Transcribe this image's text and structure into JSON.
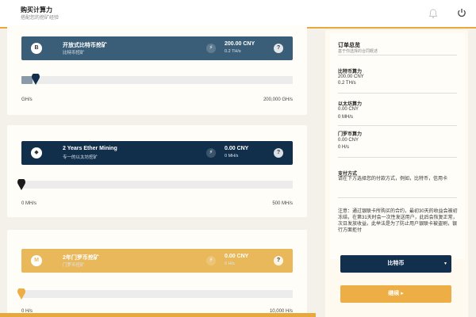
{
  "header": {
    "title": "购买计算力",
    "subtitle": "搭配您的挖矿经验"
  },
  "plans": [
    {
      "coin_icon": "B",
      "name": "开放式比特币挖矿",
      "desc": "比特币挖矿",
      "price": "200.00 CNY",
      "rate": "0.2 TH/s",
      "help": "?",
      "bolt": "⚡",
      "range_min": "GH/s",
      "range_max": "200,000 GH/s",
      "level": 0.03
    },
    {
      "coin_icon": "◆",
      "name": "2 Years Ether Mining",
      "desc": "专一的以太坊挖矿",
      "price": "0.00 CNY",
      "rate": "0 MH/s",
      "help": "?",
      "bolt": "⚡",
      "range_min": "0 MH/s",
      "range_max": "500 MH/s",
      "level": 0
    },
    {
      "coin_icon": "M",
      "name": "2年门罗币挖矿",
      "desc": "门罗币挖矿",
      "price": "0.00 CNY",
      "rate": "0 H/s",
      "help": "?",
      "bolt": "⚡",
      "range_min": "0 H/s",
      "range_max": "10,000 H/s",
      "level": 0
    }
  ],
  "summary": {
    "title": "订单总览",
    "subtitle": "基于你选择的合同概述",
    "btc_label": "比特币算力",
    "btc_price": "200.00 CNY",
    "btc_rate": "0.2 TH/s",
    "eth_label": "以太坊算力",
    "eth_price": "0.00 CNY",
    "eth_rate": "0 MH/s",
    "xmr_label": "门罗币算力",
    "xmr_price": "0.00 CNY",
    "xmr_rate": "0 H/s",
    "payment_title": "支付方式",
    "payment_text": "请在下方选择您的付款方式，例如，比特币，信用卡",
    "note": "注意：通过银联卡所购买的合约，最初30天的收益会被初冻结，在第31天时会一次性发送用户，此后会恢复正常，次日发放收益。此举法是为了防止用户银联卡被盗刷，银行方面拒付"
  },
  "buttons": {
    "method": "比特币",
    "method_caret": "▾",
    "continue": "继续 ▸"
  },
  "colors": {
    "accent": "#e9a93a",
    "navy": "#112f4b",
    "slate": "#3b5e78",
    "gold": "#e8b85a"
  }
}
